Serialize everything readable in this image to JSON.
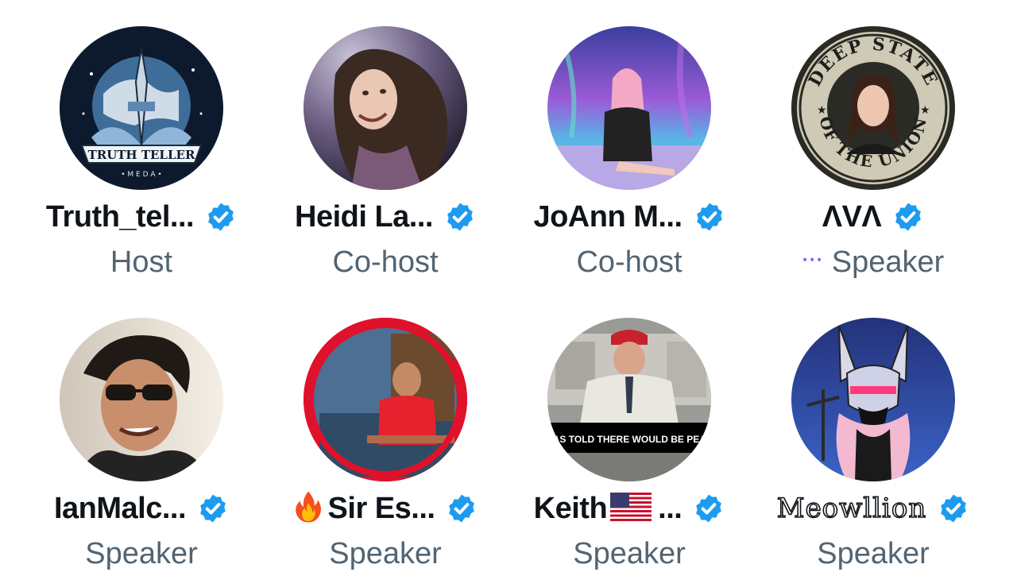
{
  "participants": [
    {
      "name": "Truth_tel...",
      "role": "Host",
      "verified": true,
      "avatar": "truth-teller-logo-avatar"
    },
    {
      "name": "Heidi La...",
      "role": "Co-host",
      "verified": true,
      "avatar": "woman-long-hair-avatar"
    },
    {
      "name": "JoAnn M...",
      "role": "Co-host",
      "verified": true,
      "avatar": "woman-aurora-avatar"
    },
    {
      "name": "ΛVΛ",
      "role": "Speaker",
      "verified": true,
      "avatar": "deep-state-seal-avatar",
      "speaking_indicator": "···",
      "seal_text_top": "DEEP STATE",
      "seal_text_bottom": "OF THE UNION"
    },
    {
      "name": "IanMalc...",
      "role": "Speaker",
      "verified": true,
      "avatar": "man-sunglasses-avatar"
    },
    {
      "name": "Sir Es...",
      "role": "Speaker",
      "verified": true,
      "avatar": "man-red-shirt-avatar",
      "prefix_icon": "fire-icon"
    },
    {
      "name": "Keith",
      "name_suffix": "...",
      "role": "Speaker",
      "verified": true,
      "avatar": "office-man-meme-avatar",
      "flag_icon": "us-flag-icon",
      "meme_caption": "I WAS TOLD THERE WOULD BE PEACE"
    },
    {
      "name": "Meowllion",
      "role": "Speaker",
      "verified": true,
      "avatar": "robot-cat-avatar"
    }
  ],
  "colors": {
    "verified_badge": "#1d9bf0",
    "name_text": "#0f1419",
    "role_text": "#536471",
    "speaking_dots": "#7856ff"
  }
}
